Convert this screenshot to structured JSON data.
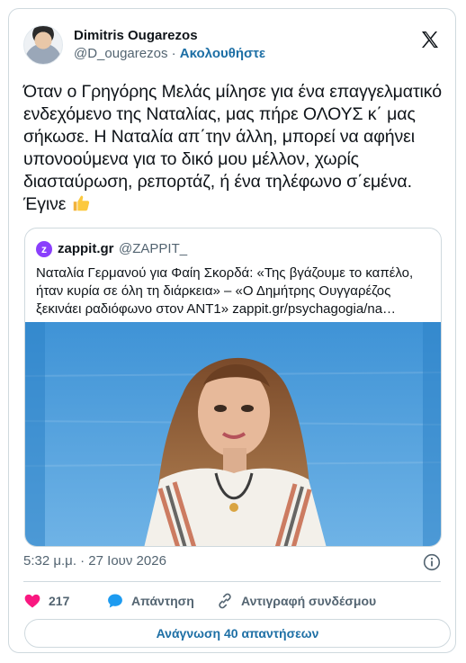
{
  "tweet": {
    "display_name": "Dimitris Ougarezos",
    "handle": "@D_ougarezos",
    "separator": "·",
    "follow_label": "Ακολουθήστε",
    "text": "Όταν ο Γρηγόρης Μελάς μίλησε για ένα επαγγελματικό ενδεχόμενο της Ναταλίας, μας πήρε ΟΛΟΥΣ κ΄ μας σήκωσε. Η Ναταλία απ΄την άλλη, μπορεί να αφήνει υπονοούμενα για το δικό μου μέλλον, χωρίς διασταύρωση, ρεπορτάζ, ή ένα τηλέφωνο σ΄εμένα. Έγινε",
    "emoji": "thumbs-up-icon"
  },
  "quote": {
    "logo_letter": "z",
    "name": "zappit.gr",
    "handle": "@ZAPPIT_",
    "text": "Ναταλία Γερμανού για Φαίη Σκορδά: «Της βγάζουμε το καπέλο, ήταν κυρία σε όλη τη διάρκεια» – «Ο Δημήτρης Ουγγαρέζος ξεκινάει ραδιόφωνο στον ΑΝΤ1» zappit.gr/psychagogia/na…"
  },
  "meta": {
    "timestamp": "5:32 μ.μ. · 27 Ιουν 2026"
  },
  "actions": {
    "likes": "217",
    "reply_label": "Απάντηση",
    "copy_link_label": "Αντιγραφή συνδέσμου"
  },
  "read_replies_label": "Ανάγνωση 40 απαντήσεων",
  "colors": {
    "link": "#1d6fa5",
    "like": "#f91880",
    "reply": "#1d9bf0",
    "border": "#cfd9de",
    "muted": "#536471"
  }
}
